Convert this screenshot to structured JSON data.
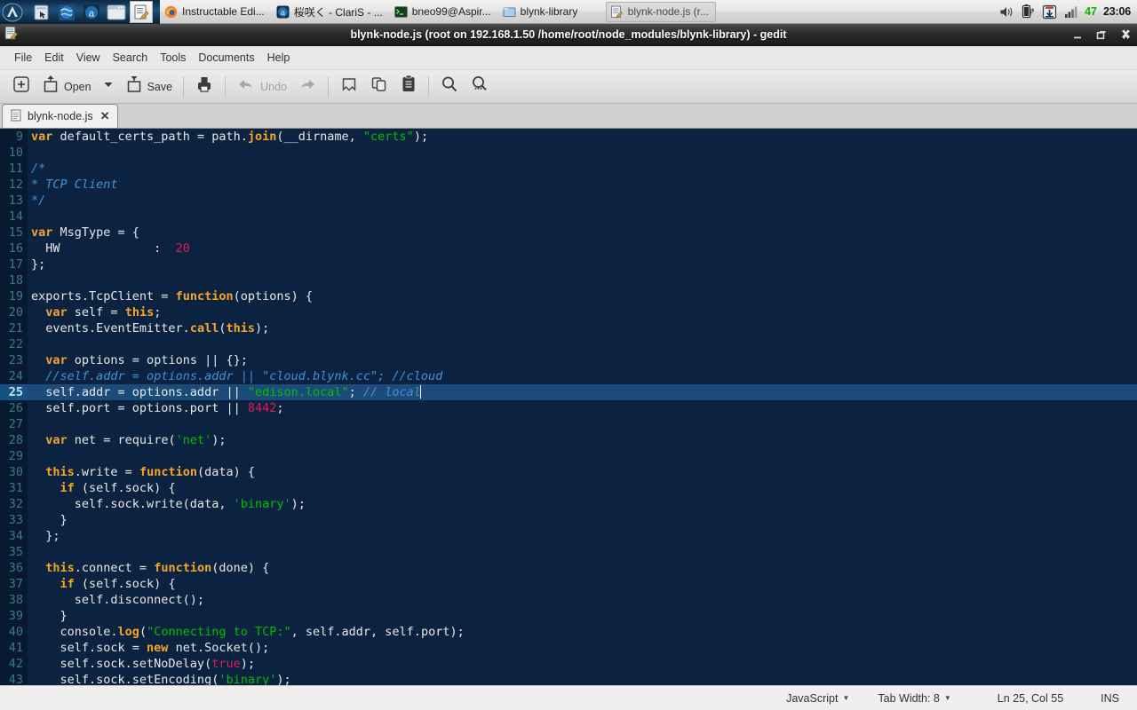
{
  "taskbar": {
    "launchers": [
      {
        "name": "app-menu-icon",
        "glyph": "arch"
      },
      {
        "name": "file-manager-icon",
        "glyph": "folder"
      },
      {
        "name": "web-browser-icon",
        "glyph": "globe"
      },
      {
        "name": "amarok-icon",
        "glyph": "circle-a"
      },
      {
        "name": "terminal-icon",
        "glyph": "window"
      },
      {
        "name": "gedit-icon",
        "glyph": "notepad"
      }
    ],
    "tasks": [
      {
        "label": "Instructable Edi...",
        "icon": "firefox-icon",
        "active": false
      },
      {
        "label": "桜咲く - ClariS - ...",
        "icon": "amarok-icon",
        "active": false
      },
      {
        "label": "bneo99@Aspir...",
        "icon": "terminal-icon",
        "active": false
      },
      {
        "label": "blynk-library",
        "icon": "folder-icon",
        "active": false
      },
      {
        "label": "blynk-node.js (r...",
        "icon": "gedit-icon",
        "active": true
      }
    ],
    "tray": {
      "icons": [
        "volume-icon",
        "battery-charging-icon",
        "software-update-icon",
        "network-signal-icon"
      ],
      "number": "47",
      "clock": "23:06"
    }
  },
  "window": {
    "title": "blynk-node.js (root on 192.168.1.50 /home/root/node_modules/blynk-library) - gedit",
    "controls": {
      "minimize": "minimize-button",
      "maximize": "maximize-button",
      "close": "close-button"
    }
  },
  "menubar": {
    "items": [
      "File",
      "Edit",
      "View",
      "Search",
      "Tools",
      "Documents",
      "Help"
    ]
  },
  "toolbar": {
    "new_label": "",
    "open_label": "Open",
    "save_label": "Save",
    "undo_label": "Undo",
    "buttons": [
      {
        "name": "new-document-button",
        "label": "",
        "icon": "plus-in-box-icon",
        "enabled": true
      },
      {
        "name": "open-button",
        "label": "Open",
        "icon": "open-folder-icon",
        "enabled": true
      },
      {
        "name": "open-dropdown-button",
        "label": "",
        "icon": "chevron-down-icon",
        "enabled": true
      },
      {
        "name": "save-button",
        "label": "Save",
        "icon": "save-icon",
        "enabled": true
      },
      {
        "name": "print-button",
        "label": "",
        "icon": "printer-icon",
        "enabled": true
      },
      {
        "name": "undo-button",
        "label": "Undo",
        "icon": "undo-arrow-icon",
        "enabled": false
      },
      {
        "name": "redo-button",
        "label": "",
        "icon": "redo-arrow-icon",
        "enabled": false
      },
      {
        "name": "cut-button",
        "label": "",
        "icon": "cut-icon",
        "enabled": true
      },
      {
        "name": "copy-button",
        "label": "",
        "icon": "copy-icon",
        "enabled": true
      },
      {
        "name": "paste-button",
        "label": "",
        "icon": "paste-clipboard-icon",
        "enabled": true
      },
      {
        "name": "find-button",
        "label": "",
        "icon": "magnifier-icon",
        "enabled": true
      },
      {
        "name": "find-replace-button",
        "label": "",
        "icon": "magnifier-replace-icon",
        "enabled": true
      }
    ]
  },
  "tabs": [
    {
      "label": "blynk-node.js",
      "icon": "document-icon",
      "close": "✕",
      "active": true
    }
  ],
  "editor": {
    "first_line": 9,
    "current_line": 25,
    "lines": [
      {
        "n": 9,
        "tokens": [
          [
            "k",
            "var"
          ],
          [
            "pl",
            " default_certs_path = path."
          ],
          [
            "fn",
            "join"
          ],
          [
            "pl",
            "(__dirname, "
          ],
          [
            "str",
            "\"certs\""
          ],
          [
            "pl",
            ");"
          ]
        ]
      },
      {
        "n": 10,
        "tokens": [
          [
            "pl",
            ""
          ]
        ]
      },
      {
        "n": 11,
        "tokens": [
          [
            "cmt",
            "/*"
          ]
        ]
      },
      {
        "n": 12,
        "tokens": [
          [
            "cmt",
            "* TCP Client"
          ]
        ]
      },
      {
        "n": 13,
        "tokens": [
          [
            "cmt",
            "*/"
          ]
        ]
      },
      {
        "n": 14,
        "tokens": [
          [
            "pl",
            ""
          ]
        ]
      },
      {
        "n": 15,
        "tokens": [
          [
            "k",
            "var"
          ],
          [
            "pl",
            " MsgType = {"
          ]
        ]
      },
      {
        "n": 16,
        "tokens": [
          [
            "pl",
            "  HW             :  "
          ],
          [
            "num",
            "20"
          ]
        ]
      },
      {
        "n": 17,
        "tokens": [
          [
            "pl",
            "};"
          ]
        ]
      },
      {
        "n": 18,
        "tokens": [
          [
            "pl",
            ""
          ]
        ]
      },
      {
        "n": 19,
        "tokens": [
          [
            "pl",
            "exports.TcpClient = "
          ],
          [
            "k",
            "function"
          ],
          [
            "pl",
            "(options) {"
          ]
        ]
      },
      {
        "n": 20,
        "tokens": [
          [
            "pl",
            "  "
          ],
          [
            "k",
            "var"
          ],
          [
            "pl",
            " self = "
          ],
          [
            "k",
            "this"
          ],
          [
            "pl",
            ";"
          ]
        ]
      },
      {
        "n": 21,
        "tokens": [
          [
            "pl",
            "  events.EventEmitter."
          ],
          [
            "fn",
            "call"
          ],
          [
            "pl",
            "("
          ],
          [
            "k",
            "this"
          ],
          [
            "pl",
            ");"
          ]
        ]
      },
      {
        "n": 22,
        "tokens": [
          [
            "pl",
            ""
          ]
        ]
      },
      {
        "n": 23,
        "tokens": [
          [
            "pl",
            "  "
          ],
          [
            "k",
            "var"
          ],
          [
            "pl",
            " options = options || {};"
          ]
        ]
      },
      {
        "n": 24,
        "tokens": [
          [
            "pl",
            "  "
          ],
          [
            "cmt",
            "//self.addr = options.addr || \"cloud.blynk.cc\"; //cloud"
          ]
        ]
      },
      {
        "n": 25,
        "tokens": [
          [
            "pl",
            "  self.addr = options.addr || "
          ],
          [
            "str",
            "\"edison.local\""
          ],
          [
            "pl",
            "; "
          ],
          [
            "cmt",
            "// local"
          ],
          [
            "caret",
            ""
          ]
        ]
      },
      {
        "n": 26,
        "tokens": [
          [
            "pl",
            "  self.port = options.port || "
          ],
          [
            "num",
            "8442"
          ],
          [
            "pl",
            ";"
          ]
        ]
      },
      {
        "n": 27,
        "tokens": [
          [
            "pl",
            ""
          ]
        ]
      },
      {
        "n": 28,
        "tokens": [
          [
            "pl",
            "  "
          ],
          [
            "k",
            "var"
          ],
          [
            "pl",
            " net = require("
          ],
          [
            "str",
            "'net'"
          ],
          [
            "pl",
            ");"
          ]
        ]
      },
      {
        "n": 29,
        "tokens": [
          [
            "pl",
            ""
          ]
        ]
      },
      {
        "n": 30,
        "tokens": [
          [
            "pl",
            "  "
          ],
          [
            "k",
            "this"
          ],
          [
            "pl",
            ".write = "
          ],
          [
            "k",
            "function"
          ],
          [
            "pl",
            "(data) {"
          ]
        ]
      },
      {
        "n": 31,
        "tokens": [
          [
            "pl",
            "    "
          ],
          [
            "k",
            "if"
          ],
          [
            "pl",
            " (self.sock) {"
          ]
        ]
      },
      {
        "n": 32,
        "tokens": [
          [
            "pl",
            "      self.sock.write(data, "
          ],
          [
            "str",
            "'binary'"
          ],
          [
            "pl",
            ");"
          ]
        ]
      },
      {
        "n": 33,
        "tokens": [
          [
            "pl",
            "    }"
          ]
        ]
      },
      {
        "n": 34,
        "tokens": [
          [
            "pl",
            "  };"
          ]
        ]
      },
      {
        "n": 35,
        "tokens": [
          [
            "pl",
            ""
          ]
        ]
      },
      {
        "n": 36,
        "tokens": [
          [
            "pl",
            "  "
          ],
          [
            "k",
            "this"
          ],
          [
            "pl",
            ".connect = "
          ],
          [
            "k",
            "function"
          ],
          [
            "pl",
            "(done) {"
          ]
        ]
      },
      {
        "n": 37,
        "tokens": [
          [
            "pl",
            "    "
          ],
          [
            "k",
            "if"
          ],
          [
            "pl",
            " (self.sock) {"
          ]
        ]
      },
      {
        "n": 38,
        "tokens": [
          [
            "pl",
            "      self.disconnect();"
          ]
        ]
      },
      {
        "n": 39,
        "tokens": [
          [
            "pl",
            "    }"
          ]
        ]
      },
      {
        "n": 40,
        "tokens": [
          [
            "pl",
            "    console."
          ],
          [
            "fn",
            "log"
          ],
          [
            "pl",
            "("
          ],
          [
            "str",
            "\"Connecting to TCP:\""
          ],
          [
            "pl",
            ", self.addr, self.port);"
          ]
        ]
      },
      {
        "n": 41,
        "tokens": [
          [
            "pl",
            "    self.sock = "
          ],
          [
            "k",
            "new"
          ],
          [
            "pl",
            " net.Socket();"
          ]
        ]
      },
      {
        "n": 42,
        "tokens": [
          [
            "pl",
            "    self.sock.setNoDelay("
          ],
          [
            "num",
            "true"
          ],
          [
            "pl",
            ");"
          ]
        ]
      },
      {
        "n": 43,
        "tokens": [
          [
            "pl",
            "    self.sock.setEncoding("
          ],
          [
            "str",
            "'binary'"
          ],
          [
            "pl",
            ");"
          ]
        ]
      }
    ]
  },
  "statusbar": {
    "language": "JavaScript",
    "tab_width": "Tab Width: 8",
    "position": "Ln 25, Col 55",
    "mode": "INS"
  },
  "colors": {
    "editor_bg": "#0b2240",
    "gutter_bg": "#081a30",
    "current_line_bg": "#1c4a79",
    "keyword": "#f5a623",
    "string": "#00c000",
    "comment": "#3f93d6",
    "number": "#e01b5a",
    "titlebar": "#262626",
    "tray_number": "#00bb00"
  }
}
